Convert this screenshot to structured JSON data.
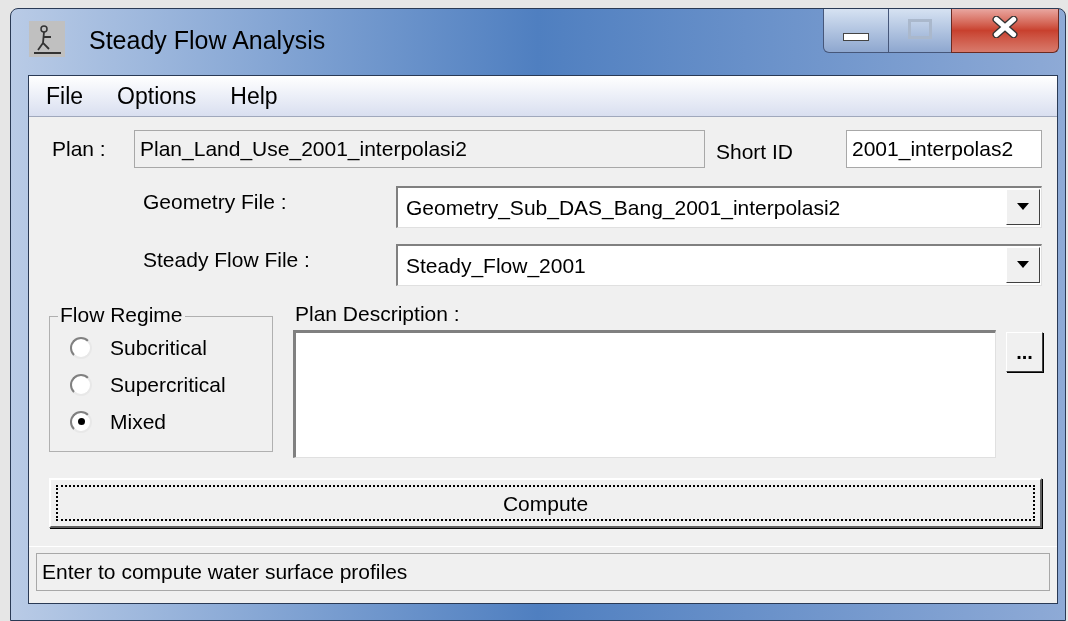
{
  "window": {
    "title": "Steady Flow Analysis"
  },
  "menu": [
    "File",
    "Options",
    "Help"
  ],
  "plan": {
    "label": "Plan :",
    "value": "Plan_Land_Use_2001_interpolasi2"
  },
  "short_id": {
    "label": "Short ID",
    "value": "2001_interpolas2"
  },
  "geometry_file": {
    "label": "Geometry File :",
    "value": "Geometry_Sub_DAS_Bang_2001_interpolasi2"
  },
  "steady_flow_file": {
    "label": "Steady Flow File :",
    "value": "Steady_Flow_2001"
  },
  "flow_regime": {
    "label": "Flow Regime",
    "options": [
      {
        "label": "Subcritical",
        "selected": false
      },
      {
        "label": "Supercritical",
        "selected": false
      },
      {
        "label": "Mixed",
        "selected": true
      }
    ]
  },
  "plan_description": {
    "label": "Plan Description :",
    "browse_button": "..."
  },
  "compute_button": {
    "label": "Compute",
    "focused": true
  },
  "status_bar": "Enter to compute water surface profiles"
}
